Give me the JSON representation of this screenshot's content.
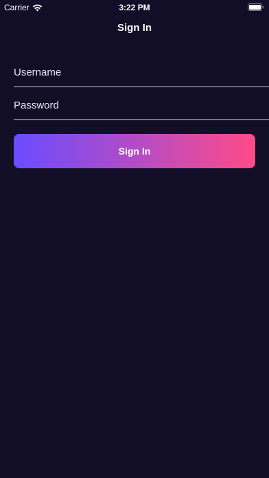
{
  "status_bar": {
    "carrier": "Carrier",
    "time": "3:22 PM",
    "wifi_icon": "wifi-icon",
    "battery_icon": "battery-icon"
  },
  "header": {
    "title": "Sign In"
  },
  "form": {
    "username": {
      "placeholder": "Username",
      "value": ""
    },
    "password": {
      "placeholder": "Password",
      "value": ""
    },
    "submit_label": "Sign In"
  },
  "colors": {
    "background": "#120e28",
    "button_gradient_start": "#6a4cff",
    "button_gradient_end": "#ff4b87",
    "text": "#ffffff"
  }
}
